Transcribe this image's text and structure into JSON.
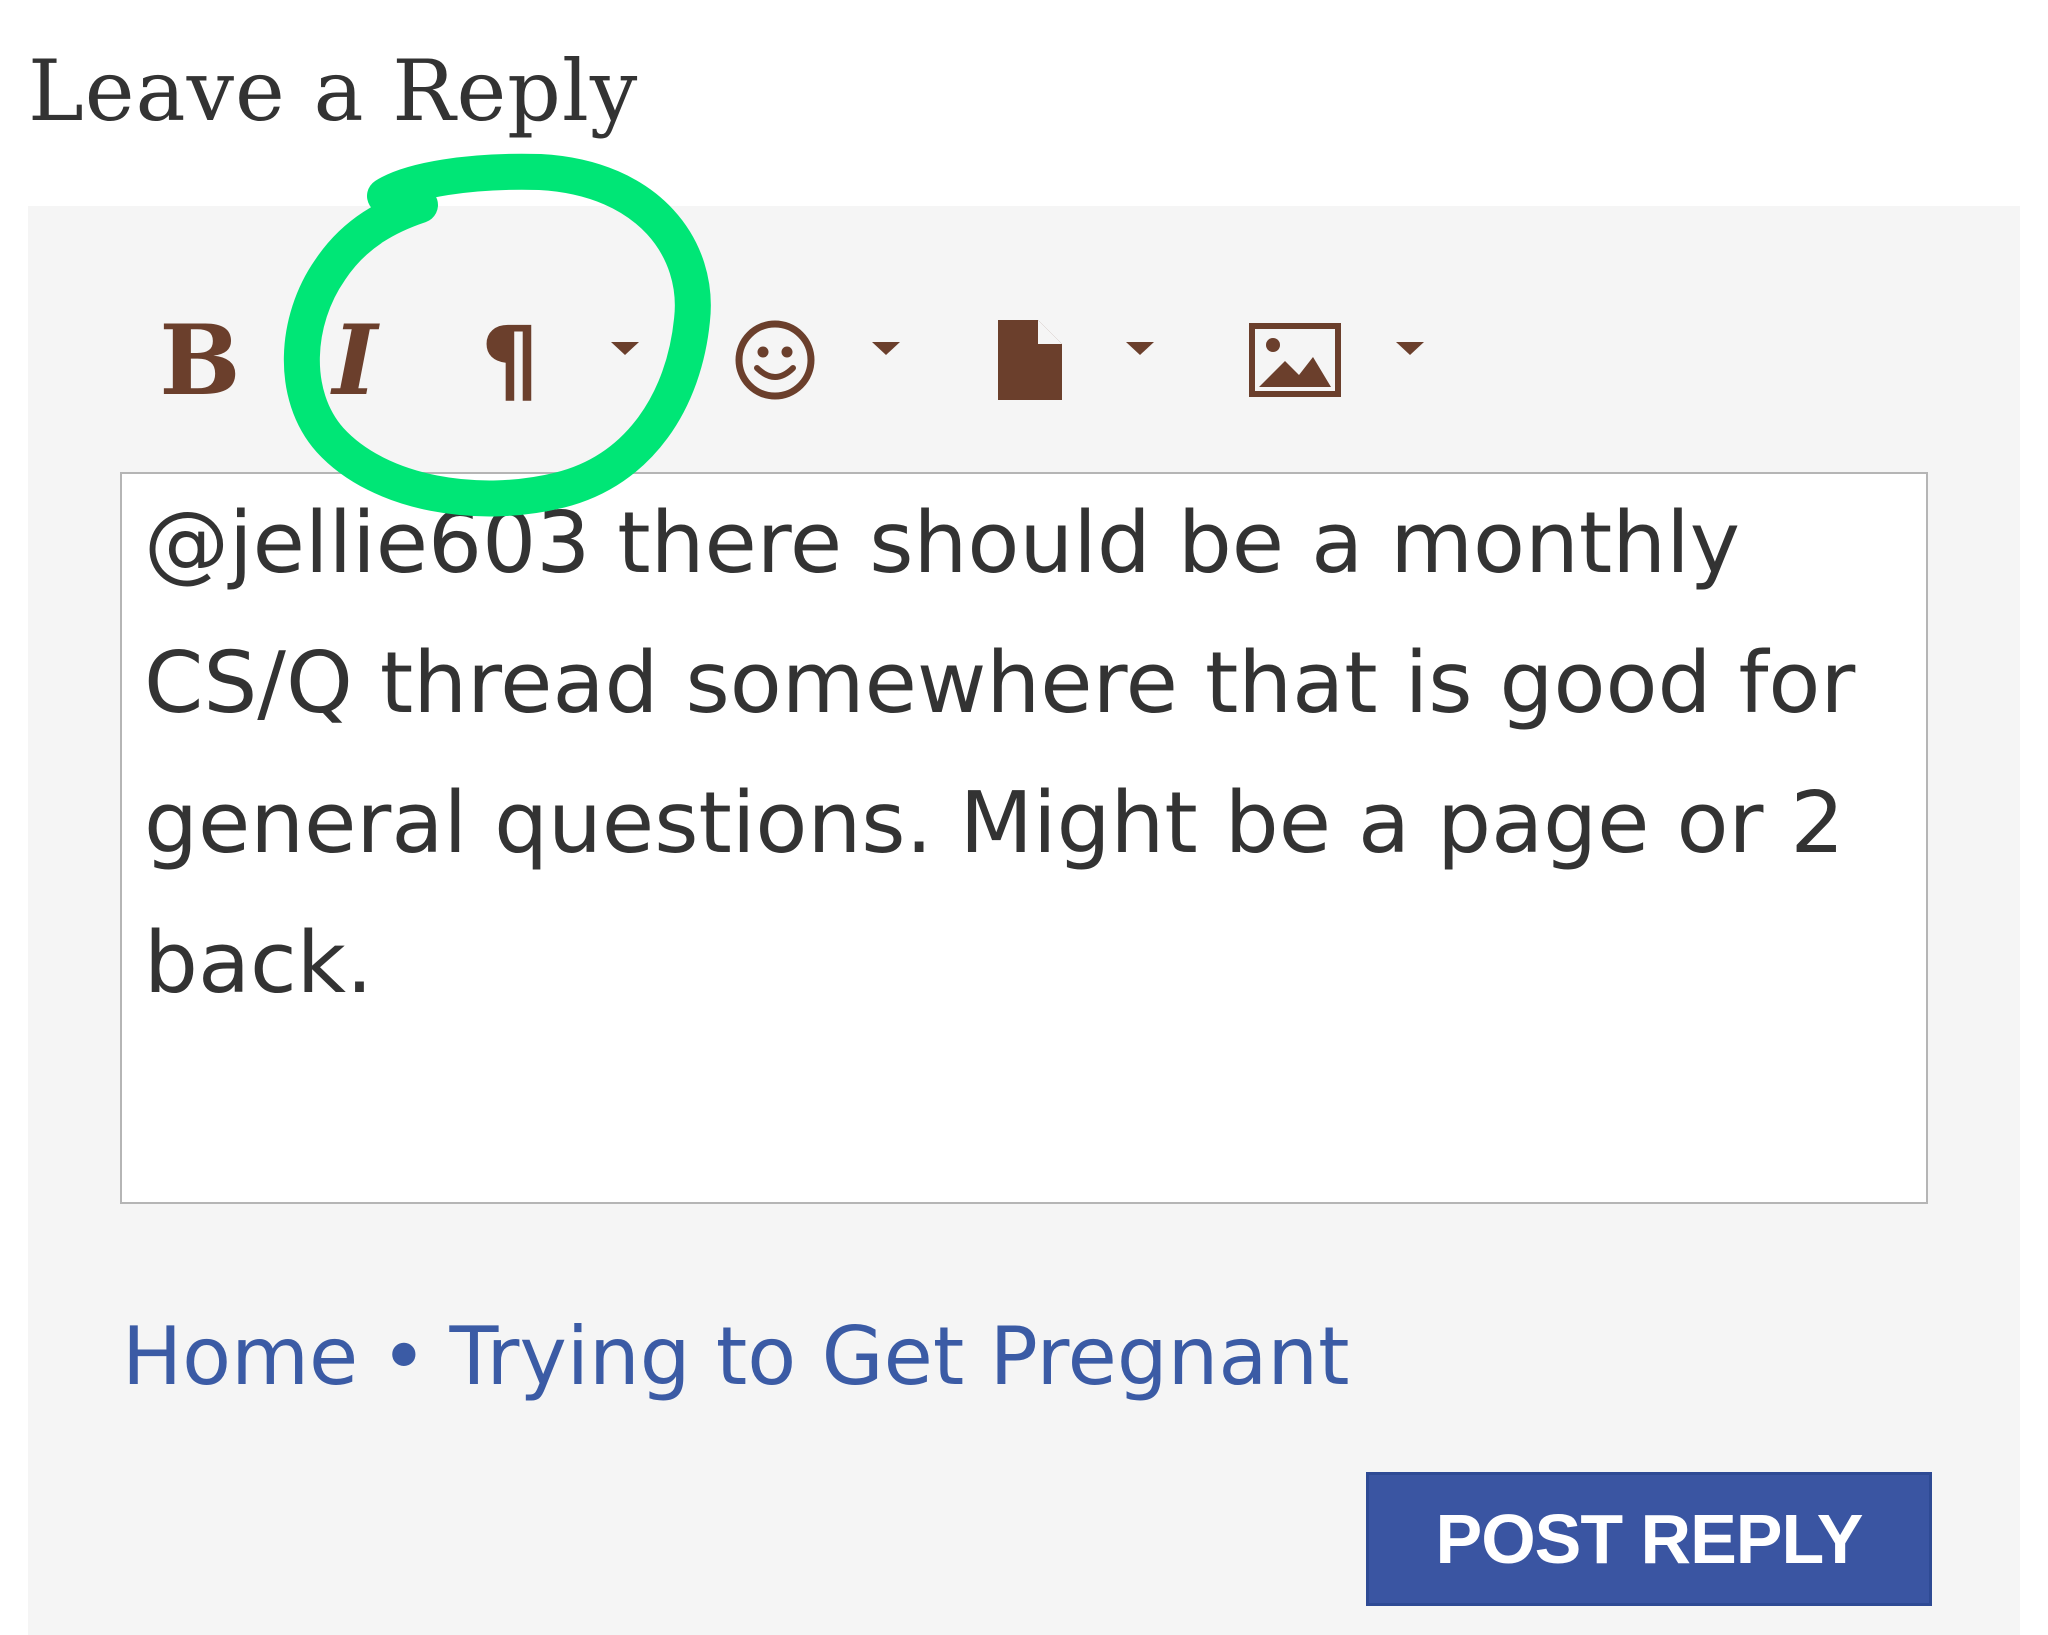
{
  "page": {
    "heading": "Leave a Reply"
  },
  "toolbar": {
    "bold_label": "B",
    "italic_label": "I",
    "paragraph_label": "¶",
    "icons": [
      "bold-icon",
      "italic-icon",
      "paragraph-icon",
      "smiley-icon",
      "file-icon",
      "image-icon",
      "chevron-down-icon"
    ]
  },
  "editor": {
    "text": "@jellie603 there should be a monthly CS/Q thread somewhere that is good for general questions. Might be a page or 2 back."
  },
  "breadcrumb": {
    "home": "Home",
    "separator": "•",
    "section": "Trying to Get Pregnant"
  },
  "actions": {
    "post_reply": "POST REPLY"
  },
  "colors": {
    "toolbar_icon": "#6b3f2c",
    "link": "#3b5ba5",
    "button": "#3a55a2",
    "panel": "#f5f5f5",
    "annotation": "#00e676"
  }
}
